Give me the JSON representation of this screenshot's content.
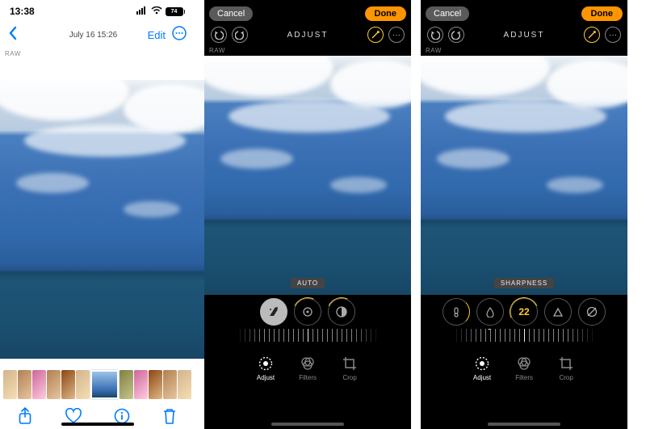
{
  "viewer": {
    "status_time": "13:38",
    "battery": "74",
    "date_line": "July 16  15:26",
    "edit_label": "Edit",
    "raw_badge": "RAW"
  },
  "editor_a": {
    "cancel": "Cancel",
    "done": "Done",
    "title": "ADJUST",
    "raw_badge": "RAW",
    "chip": "AUTO",
    "modes": {
      "adjust": "Adjust",
      "filters": "Filters",
      "crop": "Crop"
    }
  },
  "editor_b": {
    "cancel": "Cancel",
    "done": "Done",
    "title": "ADJUST",
    "raw_badge": "RAW",
    "chip": "SHARPNESS",
    "value": "22",
    "modes": {
      "adjust": "Adjust",
      "filters": "Filters",
      "crop": "Crop"
    }
  }
}
